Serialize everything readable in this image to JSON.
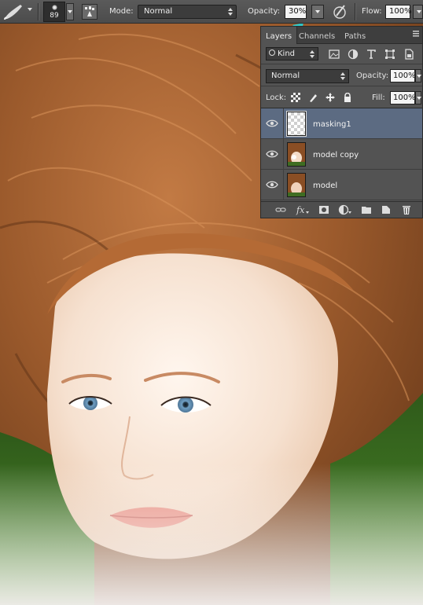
{
  "options_bar": {
    "brush_size": "89",
    "mode_label": "Mode:",
    "mode_value": "Normal",
    "opacity_label": "Opacity:",
    "opacity_value": "30%",
    "flow_label": "Flow:",
    "flow_value": "100%"
  },
  "layers_panel": {
    "tabs": [
      {
        "label": "Layers",
        "active": true
      },
      {
        "label": "Channels",
        "active": false
      },
      {
        "label": "Paths",
        "active": false
      }
    ],
    "filter_kind": "Kind",
    "blend_mode": "Normal",
    "opacity_label": "Opacity:",
    "opacity_value": "100%",
    "lock_label": "Lock:",
    "fill_label": "Fill:",
    "fill_value": "100%",
    "layers": [
      {
        "name": "masking1",
        "selected": true,
        "thumbnail": "transparent"
      },
      {
        "name": "model copy",
        "selected": false,
        "thumbnail": "photo"
      },
      {
        "name": "model",
        "selected": false,
        "thumbnail": "photo"
      }
    ],
    "bottom_icons": [
      "link-layers-icon",
      "fx-icon",
      "add-mask-icon",
      "adjustment-layer-icon",
      "new-group-icon",
      "new-layer-icon",
      "delete-layer-icon"
    ]
  },
  "annotations": {
    "arrow_color": "#2fc4c4",
    "selection_color": "#5c6b82"
  }
}
